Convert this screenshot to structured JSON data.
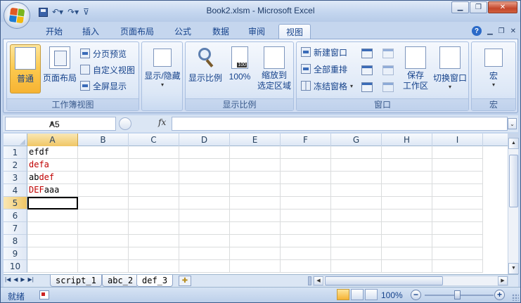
{
  "window": {
    "title": "Book2.xlsm - Microsoft Excel",
    "minimize_icon": "minimize-icon",
    "restore_icon": "restore-icon",
    "close_icon": "close-icon"
  },
  "qat": {
    "save_icon": "save-icon",
    "undo_icon": "undo-icon",
    "redo_icon": "redo-icon",
    "customize_icon": "customize-qat-icon"
  },
  "tabs": [
    "开始",
    "插入",
    "页面布局",
    "公式",
    "数据",
    "审阅",
    "视图"
  ],
  "active_tab": "视图",
  "ribbon": {
    "workbook_views": {
      "label": "工作簿视图",
      "normal": "普通",
      "page_layout": "页面布局",
      "page_break_preview": "分页预览",
      "custom_views": "自定义视图",
      "full_screen": "全屏显示"
    },
    "show_hide": {
      "label": "显示/隐藏"
    },
    "zoom": {
      "label": "显示比例",
      "zoom": "显示比例",
      "hundred": "100%",
      "zoom_to_selection_1": "缩放到",
      "zoom_to_selection_2": "选定区域"
    },
    "window": {
      "label": "窗口",
      "new_window": "新建窗口",
      "arrange_all": "全部重排",
      "freeze_panes": "冻结窗格",
      "save_workspace_1": "保存",
      "save_workspace_2": "工作区",
      "switch_windows": "切换窗口"
    },
    "macros": {
      "label": "宏",
      "macros": "宏"
    }
  },
  "formula_bar": {
    "name_box": "A5",
    "fx": "fx",
    "content": ""
  },
  "grid": {
    "columns": [
      "A",
      "B",
      "C",
      "D",
      "E",
      "F",
      "G",
      "H",
      "I"
    ],
    "rows": [
      "1",
      "2",
      "3",
      "4",
      "5",
      "6",
      "7",
      "8",
      "9",
      "10"
    ],
    "active_cell": "A5",
    "cells": {
      "A1": [
        {
          "text": "efdf",
          "color": "#000000"
        }
      ],
      "A2": [
        {
          "text": "defa",
          "color": "#c00000"
        }
      ],
      "A3": [
        {
          "text": "ab",
          "color": "#000000"
        },
        {
          "text": "def",
          "color": "#c00000"
        }
      ],
      "A4": [
        {
          "text": "DEF",
          "color": "#c00000"
        },
        {
          "text": "aaa",
          "color": "#000000"
        }
      ]
    }
  },
  "sheets": [
    "script_1",
    "abc_2",
    "def_3"
  ],
  "active_sheet": "def_3",
  "status": {
    "ready": "就绪",
    "zoom": "100%"
  },
  "colors": {
    "accent_text": "#15428b",
    "red_text": "#c00000",
    "active_button": "#fcc94e"
  }
}
